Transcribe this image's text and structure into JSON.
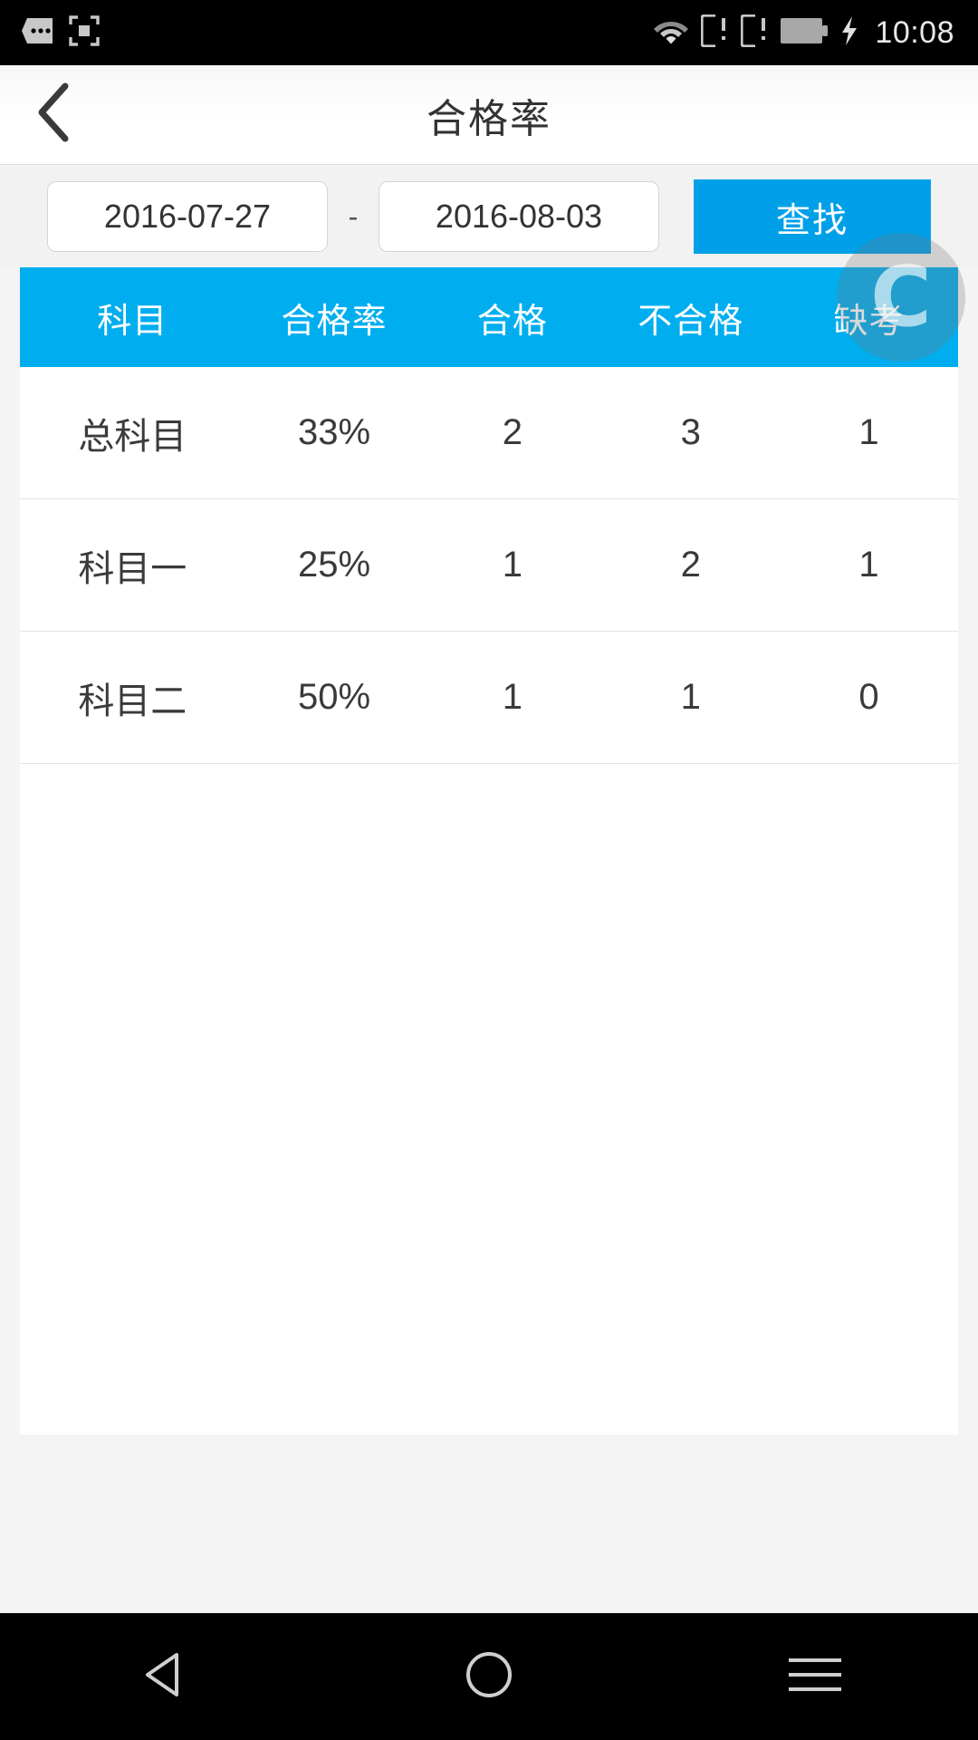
{
  "status_bar": {
    "icons": [
      "messages-icon",
      "screenshot-icon",
      "wifi-icon",
      "sim1-icon",
      "sim2-icon",
      "battery-icon",
      "charging-bolt-icon"
    ],
    "time": "10:08"
  },
  "header": {
    "back_icon": "chevron-left-icon",
    "title": "合格率"
  },
  "filter": {
    "start_date": "2016-07-27",
    "separator": "-",
    "end_date": "2016-08-03",
    "search_label": "查找"
  },
  "table": {
    "columns": [
      "科目",
      "合格率",
      "合格",
      "不合格",
      "缺考"
    ],
    "rows": [
      [
        "总科目",
        "33%",
        "2",
        "3",
        "1"
      ],
      [
        "科目一",
        "25%",
        "1",
        "2",
        "1"
      ],
      [
        "科目二",
        "50%",
        "1",
        "1",
        "0"
      ]
    ]
  },
  "watermark": {
    "glyph": "C"
  },
  "nav_bar": {
    "items": [
      "back-triangle-icon",
      "home-circle-icon",
      "menu-lines-icon"
    ]
  },
  "colors": {
    "accent": "#00aeef",
    "button": "#00a0e9",
    "status_bar": "#000000",
    "page_bg": "#f2f2f2",
    "table_bg": "#ffffff",
    "text": "#333333"
  }
}
